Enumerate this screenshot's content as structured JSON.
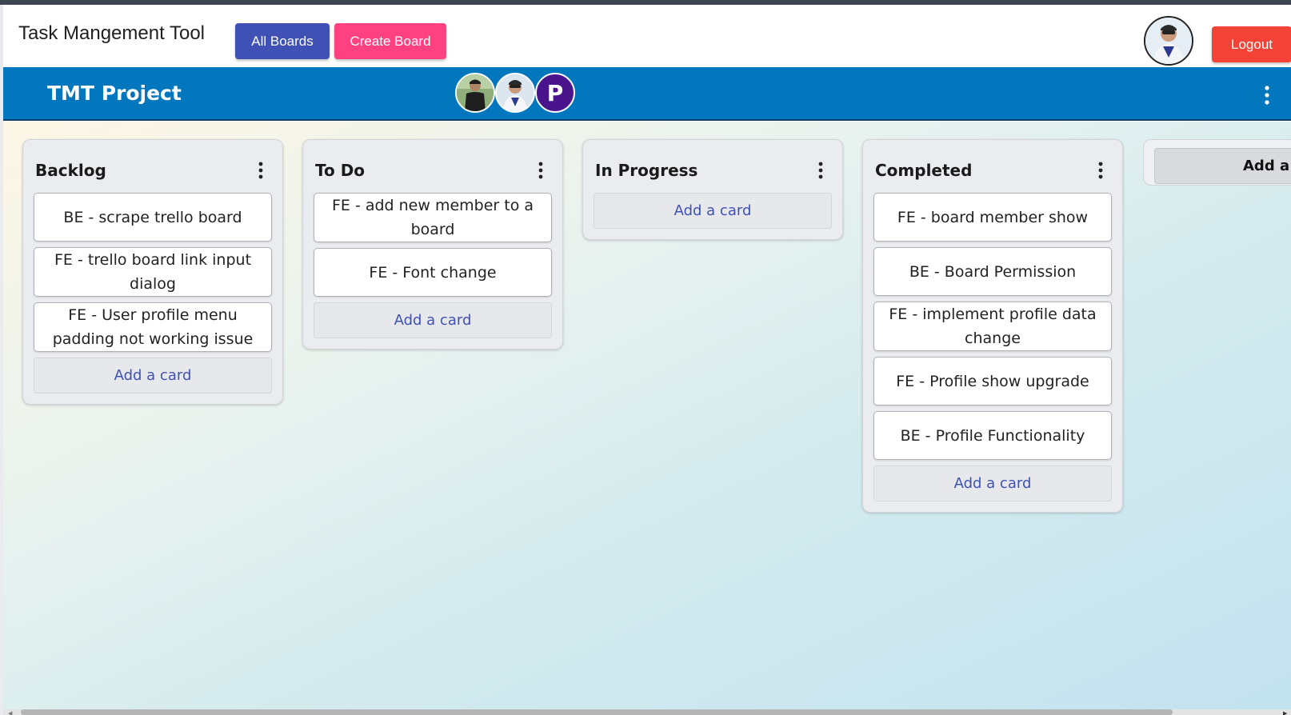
{
  "navbar": {
    "app_title": "Task Mangement Tool",
    "all_boards_label": "All Boards",
    "create_board_label": "Create Board",
    "logout_label": "Logout"
  },
  "board": {
    "title": "TMT Project",
    "members": [
      {
        "name": "member-1",
        "initial": ""
      },
      {
        "name": "member-2",
        "initial": ""
      },
      {
        "name": "member-3",
        "initial": "P"
      }
    ]
  },
  "lists": [
    {
      "title": "Backlog",
      "cards": [
        "BE - scrape trello board",
        "FE - trello board link input dialog",
        "FE - User profile menu padding not working issue"
      ],
      "add_card_label": "Add a card"
    },
    {
      "title": "To Do",
      "cards": [
        "FE - add new member to a board",
        "FE - Font change"
      ],
      "add_card_label": "Add a card"
    },
    {
      "title": "In Progress",
      "cards": [],
      "add_card_label": "Add a card"
    },
    {
      "title": "Completed",
      "cards": [
        "FE - board member show",
        "BE - Board Permission",
        "FE - implement profile data change",
        "FE - Profile show upgrade",
        "BE - Profile Functionality"
      ],
      "add_card_label": "Add a card"
    }
  ],
  "add_list_label": "Add a Li",
  "colors": {
    "primary": "#3f51b5",
    "accent": "#ff4081",
    "danger": "#f44336",
    "board_header": "#0277bd",
    "member_p": "#4a148c"
  }
}
